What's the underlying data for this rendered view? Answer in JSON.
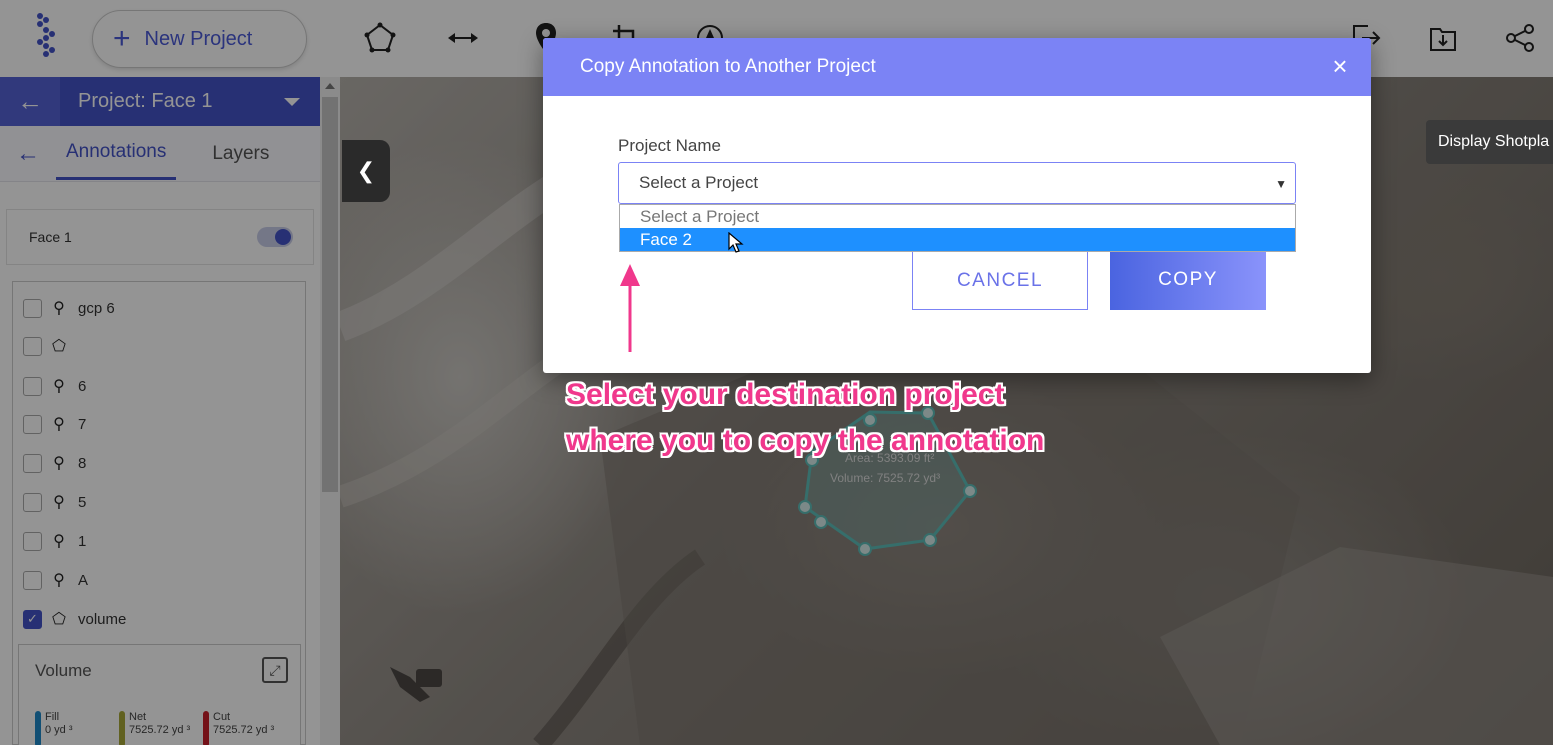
{
  "topbar": {
    "new_project_label": "New Project",
    "tools": [
      "polygon-icon",
      "ruler-icon",
      "marker-icon",
      "crop-icon",
      "compass-icon",
      "export-icon",
      "download-icon",
      "share-icon"
    ]
  },
  "sidebar": {
    "project_title": "Project: Face 1",
    "tabs": {
      "annotations": "Annotations",
      "layers": "Layers"
    },
    "group_name": "Face 1",
    "annotations": [
      {
        "label": "gcp 6",
        "icon": "marker-icon",
        "checked": false
      },
      {
        "label": "",
        "icon": "polygon-icon",
        "checked": false
      },
      {
        "label": "6",
        "icon": "marker-icon",
        "checked": false
      },
      {
        "label": "7",
        "icon": "marker-icon",
        "checked": false
      },
      {
        "label": "8",
        "icon": "marker-icon",
        "checked": false
      },
      {
        "label": "5",
        "icon": "marker-icon",
        "checked": false
      },
      {
        "label": "1",
        "icon": "marker-icon",
        "checked": false
      },
      {
        "label": "A",
        "icon": "marker-icon",
        "checked": false
      },
      {
        "label": "volume",
        "icon": "polygon-icon",
        "checked": true
      }
    ],
    "volume": {
      "title": "Volume",
      "fill_label": "Fill",
      "fill_value": "0 yd ³",
      "net_label": "Net",
      "net_value": "7525.72 yd ³",
      "cut_label": "Cut",
      "cut_value": "7525.72 yd ³",
      "colors": {
        "fill": "#1e88c8",
        "net": "#a8a838",
        "cut": "#c81e2a"
      }
    }
  },
  "map": {
    "tooltip": "Display Shotpla",
    "polygon_area": "Area: 5393.09 ft²",
    "polygon_volume": "Volume: 7525.72 yd³"
  },
  "modal": {
    "title": "Copy Annotation to Another Project",
    "field_label": "Project Name",
    "select_value": "Select a Project",
    "options": [
      "Select a Project",
      "Face 2"
    ],
    "highlighted_option": "Face 2",
    "cancel_label": "CANCEL",
    "copy_label": "COPY"
  },
  "callout": {
    "line1": "Select your destination project",
    "line2": "where you to copy the annotation",
    "color": "#f0388c"
  },
  "colors": {
    "accent": "#4453c9",
    "modal_header": "#7b83f5",
    "highlight": "#1e90ff"
  }
}
